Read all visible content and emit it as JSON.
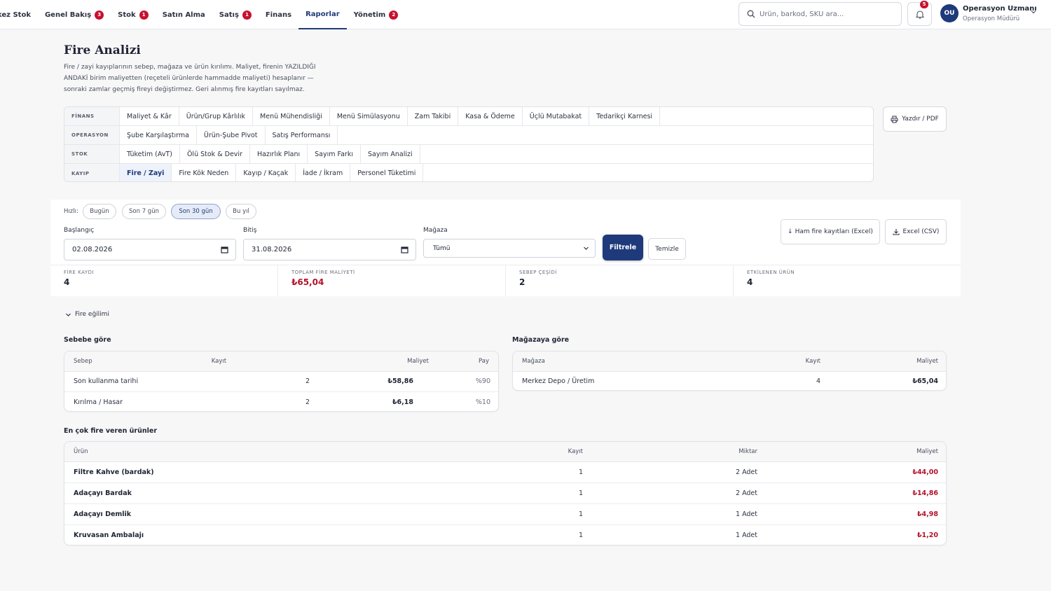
{
  "nav": {
    "items": [
      {
        "label": "kez Stok",
        "badge": ""
      },
      {
        "label": "Genel Bakış",
        "badge": "3"
      },
      {
        "label": "Stok",
        "badge": "1"
      },
      {
        "label": "Satın Alma",
        "badge": ""
      },
      {
        "label": "Satış",
        "badge": "1"
      },
      {
        "label": "Finans",
        "badge": ""
      },
      {
        "label": "Raporlar",
        "badge": ""
      },
      {
        "label": "Yönetim",
        "badge": "2"
      }
    ],
    "active": "Raporlar"
  },
  "search": {
    "placeholder": "Ürün, barkod, SKU ara..."
  },
  "notifications": {
    "count": "5"
  },
  "user": {
    "initials": "OU",
    "name": "Operasyon Uzmanı",
    "role": "Operasyon Müdürü"
  },
  "page": {
    "title": "Fire Analizi",
    "description": "Fire / zayi kayıplarının sebep, mağaza ve ürün kırılımı. Maliyet, firenin YAZILDIĞI ANDAKİ birim maliyetten (reçeteli ürünlerde hammadde maliyeti) hesaplanır — sonraki zamlar geçmiş fireyi değiştirmez. Geri alınmış fire kayıtları sayılmaz."
  },
  "report_tabs": [
    {
      "category": "FİNANS",
      "items": [
        "Maliyet & Kâr",
        "Ürün/Grup Kârlılık",
        "Menü Mühendisliği",
        "Menü Simülasyonu",
        "Zam Takibi",
        "Kasa & Ödeme",
        "Üçlü Mutabakat",
        "Tedarikçi Karnesi"
      ]
    },
    {
      "category": "OPERASYON",
      "items": [
        "Şube Karşılaştırma",
        "Ürün-Şube Pivot",
        "Satış Performansı"
      ]
    },
    {
      "category": "STOK",
      "items": [
        "Tüketim (AvT)",
        "Ölü Stok & Devir",
        "Hazırlık Planı",
        "Sayım Farkı",
        "Sayım Analizi"
      ]
    },
    {
      "category": "KAYIP",
      "items": [
        "Fire / Zayi",
        "Fire Kök Neden",
        "Kayıp / Kaçak",
        "İade / İkram",
        "Personel Tüketimi"
      ]
    }
  ],
  "active_tab": "Fire / Zayi",
  "print_label": "Yazdır / PDF",
  "filters": {
    "quick_label": "Hızlı:",
    "quick": [
      "Bugün",
      "Son 7 gün",
      "Son 30 gün",
      "Bu yıl"
    ],
    "quick_active": "Son 30 gün",
    "start_label": "Başlangıç",
    "start_value": "02.08.2026",
    "end_label": "Bitiş",
    "end_value": "31.08.2026",
    "store_label": "Mağaza",
    "store_value": "Tümü",
    "filter_btn": "Filtrele",
    "clear_btn": "Temizle",
    "raw_export": "Ham fire kayıtları (Excel)",
    "csv_export": "Excel (CSV)"
  },
  "stats": [
    {
      "label": "FİRE KAYDI",
      "value": "4"
    },
    {
      "label": "TOPLAM FİRE MALİYETİ",
      "value": "₺65,04"
    },
    {
      "label": "SEBEP ÇEŞİDİ",
      "value": "2"
    },
    {
      "label": "ETKİLENEN ÜRÜN",
      "value": "4"
    }
  ],
  "trend_toggle": "Fire eğilimi",
  "by_reason": {
    "title": "Sebebe göre",
    "columns": [
      "Sebep",
      "Kayıt",
      "Maliyet",
      "Pay"
    ],
    "rows": [
      [
        "Son kullanma tarihi",
        "2",
        "₺58,86",
        "%90"
      ],
      [
        "Kırılma / Hasar",
        "2",
        "₺6,18",
        "%10"
      ]
    ]
  },
  "by_store": {
    "title": "Mağazaya göre",
    "columns": [
      "Mağaza",
      "Kayıt",
      "Maliyet"
    ],
    "rows": [
      [
        "Merkez Depo / Üretim",
        "4",
        "₺65,04"
      ]
    ]
  },
  "top_products": {
    "title": "En çok fire veren ürünler",
    "columns": [
      "Ürün",
      "Kayıt",
      "Miktar",
      "Maliyet"
    ],
    "rows": [
      [
        "Filtre Kahve (bardak)",
        "1",
        "2 Adet",
        "₺44,00"
      ],
      [
        "Adaçayı Bardak",
        "1",
        "2 Adet",
        "₺14,86"
      ],
      [
        "Adaçayı Demlik",
        "1",
        "1 Adet",
        "₺4,98"
      ],
      [
        "Kruvasan Ambalajı",
        "1",
        "1 Adet",
        "₺1,20"
      ]
    ]
  },
  "colors": {
    "brand": "#1f3a7a",
    "accent_red": "#b3122a",
    "badge": "#c8102e"
  }
}
